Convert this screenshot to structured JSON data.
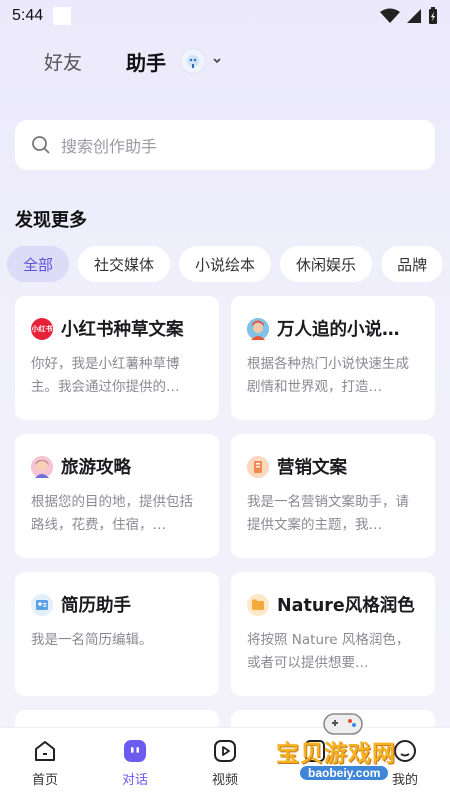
{
  "status_bar": {
    "time": "5:44"
  },
  "header": {
    "tab_friends": "好友",
    "tab_assistant": "助手"
  },
  "search": {
    "placeholder": "搜索创作助手"
  },
  "section": {
    "title": "发现更多"
  },
  "categories": [
    {
      "label": "全部",
      "active": true
    },
    {
      "label": "社交媒体",
      "active": false
    },
    {
      "label": "小说绘本",
      "active": false
    },
    {
      "label": "休闲娱乐",
      "active": false
    },
    {
      "label": "品牌",
      "active": false
    }
  ],
  "cards": [
    {
      "title": "小红书种草文案",
      "desc": "你好，我是小红薯种草博主。我会通过你提供的…",
      "icon": "xiaohongshu-icon",
      "icon_text": "小红书",
      "icon_color": "#e8213a"
    },
    {
      "title": "万人追的小说…",
      "desc": "根据各种热门小说快速生成剧情和世界观，打造…",
      "icon": "novel-avatar-icon",
      "icon_color": "#f08a4b"
    },
    {
      "title": "旅游攻略",
      "desc": "根据您的目的地，提供包括路线，花费，住宿，…",
      "icon": "travel-avatar-icon",
      "icon_color": "#e86b8a"
    },
    {
      "title": "营销文案",
      "desc": "我是一名营销文案助手，请提供文案的主题，我…",
      "icon": "marketing-icon",
      "icon_color": "#f49a5a"
    },
    {
      "title": "简历助手",
      "desc": "我是一名简历编辑。",
      "icon": "resume-icon",
      "icon_color": "#5aa0e6"
    },
    {
      "title": "Nature风格润色",
      "desc": "将按照 Nature 风格润色，或者可以提供想要…",
      "icon": "nature-icon",
      "icon_color": "#f3a93b"
    }
  ],
  "bottom_nav": [
    {
      "label": "首页",
      "icon": "home-icon",
      "active": false
    },
    {
      "label": "对话",
      "icon": "chat-icon",
      "active": true
    },
    {
      "label": "视频",
      "icon": "video-icon",
      "active": false
    },
    {
      "label": "",
      "icon": "create-icon",
      "active": false
    },
    {
      "label": "我的",
      "icon": "profile-icon",
      "active": false
    }
  ],
  "watermark": {
    "text": "宝贝游戏网",
    "url": "baobeiy.com"
  },
  "colors": {
    "accent": "#6b5cf0",
    "chip_active_bg": "#dcdbf8"
  }
}
